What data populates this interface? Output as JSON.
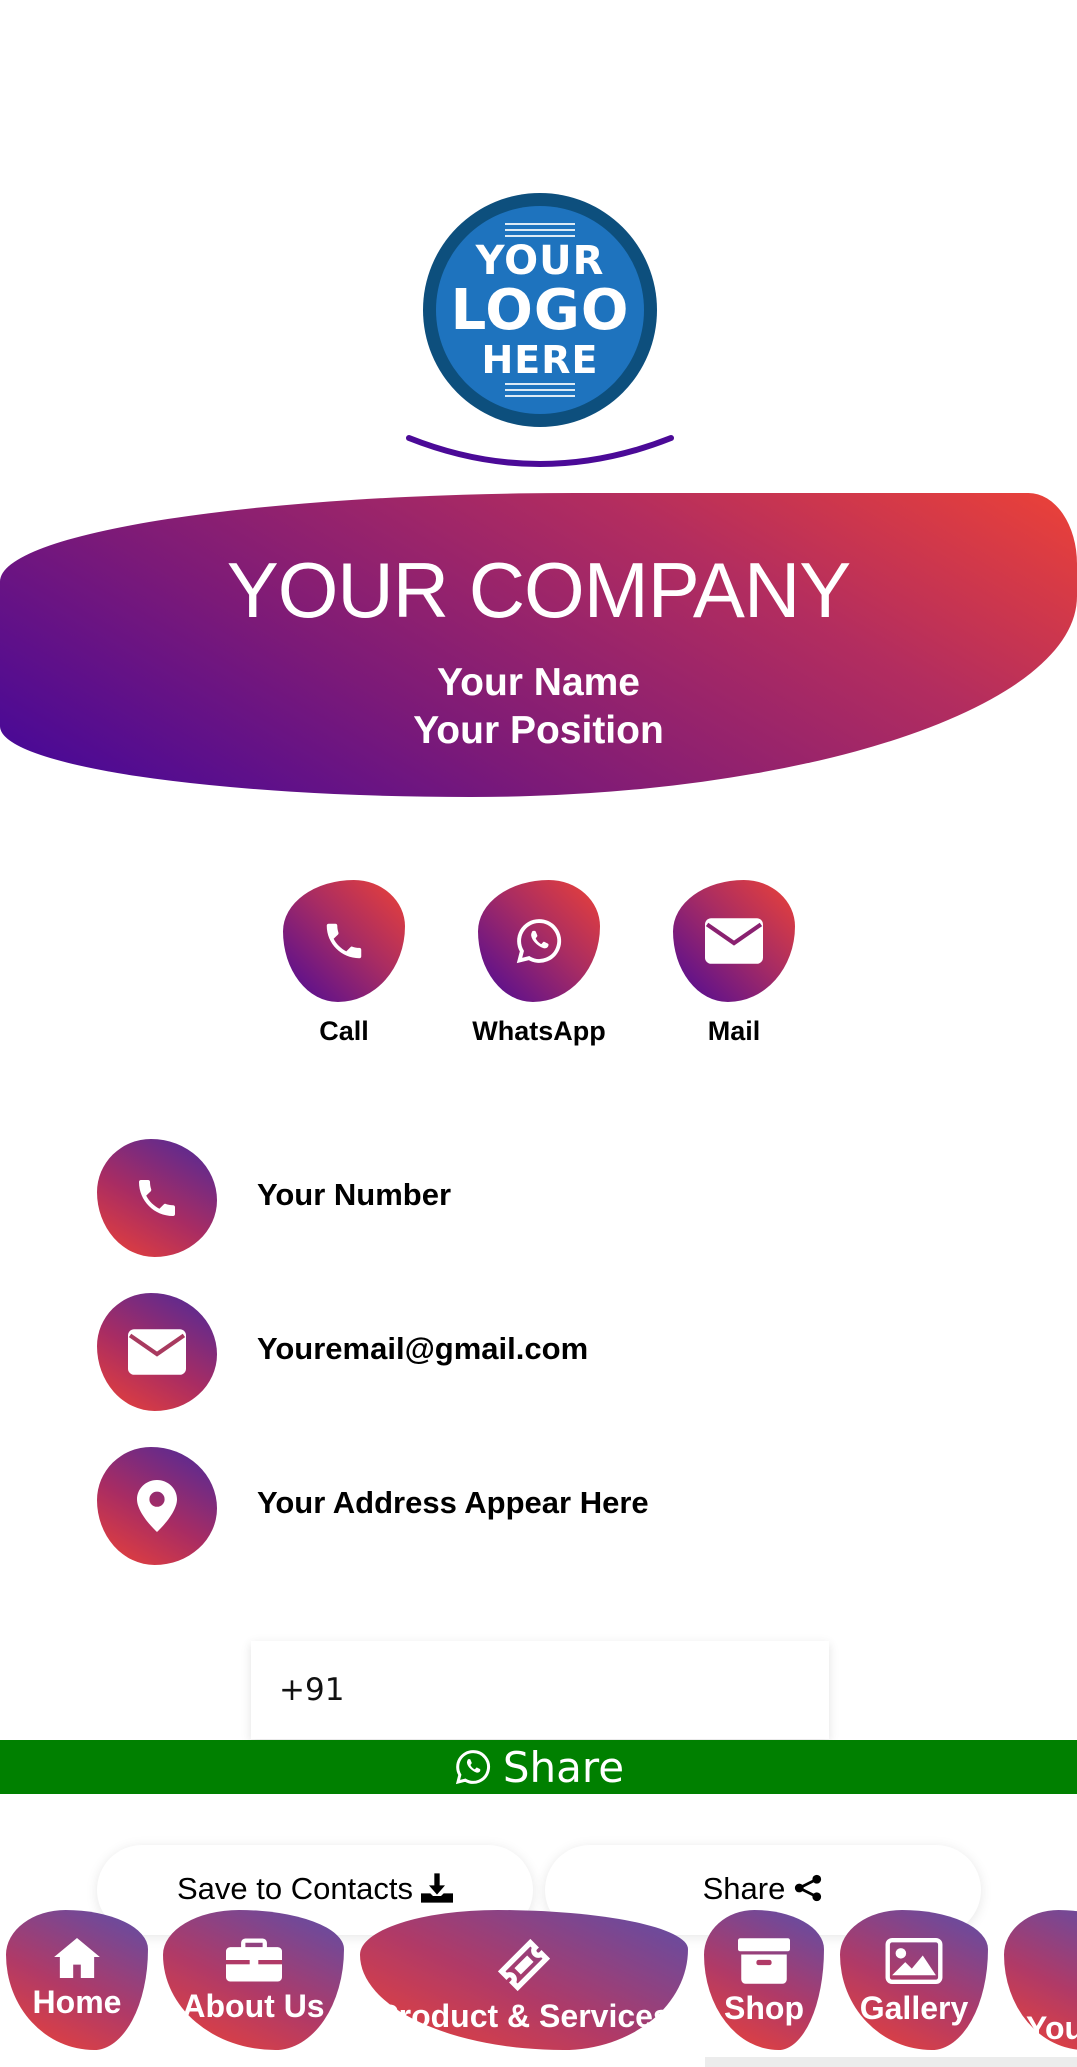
{
  "logo": {
    "line1": "YOUR",
    "line2": "LOGO",
    "line3": "HERE"
  },
  "banner": {
    "company": "YOUR COMPANY",
    "name": "Your Name",
    "position": "Your Position"
  },
  "actions": [
    {
      "label": "Call",
      "icon": "phone-icon"
    },
    {
      "label": "WhatsApp",
      "icon": "whatsapp-icon"
    },
    {
      "label": "Mail",
      "icon": "envelope-icon"
    }
  ],
  "contacts": [
    {
      "text": "Your Number",
      "icon": "phone-icon"
    },
    {
      "text": "Youremail@gmail.com",
      "icon": "envelope-icon"
    },
    {
      "text": "Your Address Appear Here",
      "icon": "map-pin-icon"
    }
  ],
  "share_form": {
    "phone_value": "+91",
    "share_label": "Share"
  },
  "buttons": {
    "save_contacts": "Save to Contacts",
    "share": "Share"
  },
  "nav": [
    {
      "label": "Home",
      "icon": "home-icon"
    },
    {
      "label": "About Us",
      "icon": "briefcase-icon"
    },
    {
      "label": "Product & Services",
      "icon": "ticket-icon"
    },
    {
      "label": "Shop",
      "icon": "archive-box-icon"
    },
    {
      "label": "Gallery",
      "icon": "image-icon"
    },
    {
      "label": "You"
    }
  ],
  "colors": {
    "gradient_start": "#40069c",
    "gradient_end": "#ec4237",
    "share_bar": "#008000",
    "logo_blue": "#1e73be",
    "logo_ring": "#0d4f7d"
  }
}
